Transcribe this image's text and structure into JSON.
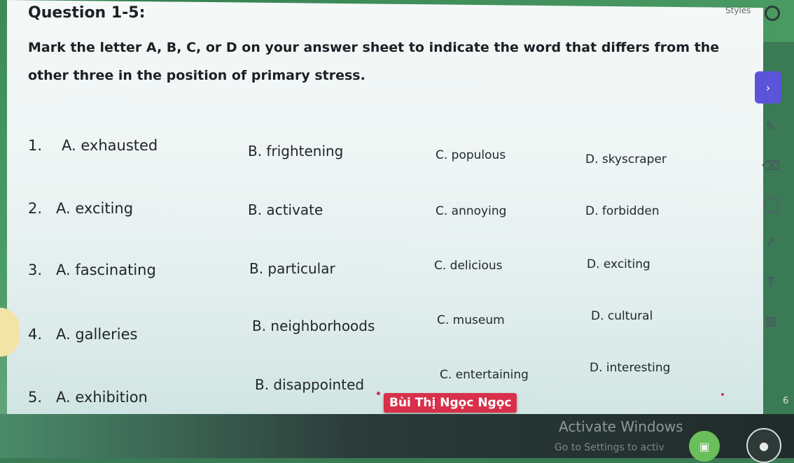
{
  "title": "Question 1-5:",
  "instruction": "Mark the letter A, B, C, or D on your answer sheet to indicate the word that differs from the other three in the position of primary stress.",
  "questions": [
    {
      "num": "1.",
      "a": "A. exhausted",
      "b": "B. frightening",
      "c": "C. populous",
      "d": "D. skyscraper"
    },
    {
      "num": "2.",
      "a": "A. exciting",
      "b": "B. activate",
      "c": "C. annoying",
      "d": "D. forbidden"
    },
    {
      "num": "3.",
      "a": "A. fascinating",
      "b": "B. particular",
      "c": "C. delicious",
      "d": "D. exciting"
    },
    {
      "num": "4.",
      "a": "A. galleries",
      "b": "B. neighborhoods",
      "c": "C. museum",
      "d": "D. cultural"
    },
    {
      "num": "5.",
      "a": "A. exhibition",
      "b": "B. disappointed",
      "c": "C. entertaining",
      "d": "D. interesting"
    }
  ],
  "name_tag": "Bùi Thị Ngọc Ngọc",
  "toolbar": {
    "styles_label": "Styles"
  },
  "watermark": {
    "line1": "Activate Windows",
    "line2": "Go to Settings to activ"
  },
  "page_number": "6",
  "colors": {
    "name_tag_bg": "#d8304b",
    "accent_purple": "#5b54d9",
    "slide_bg": "#eef5f4"
  },
  "icons": [
    "pen-icon",
    "eraser-icon",
    "rectangle-icon",
    "arrow-icon",
    "text-icon",
    "image-icon"
  ]
}
